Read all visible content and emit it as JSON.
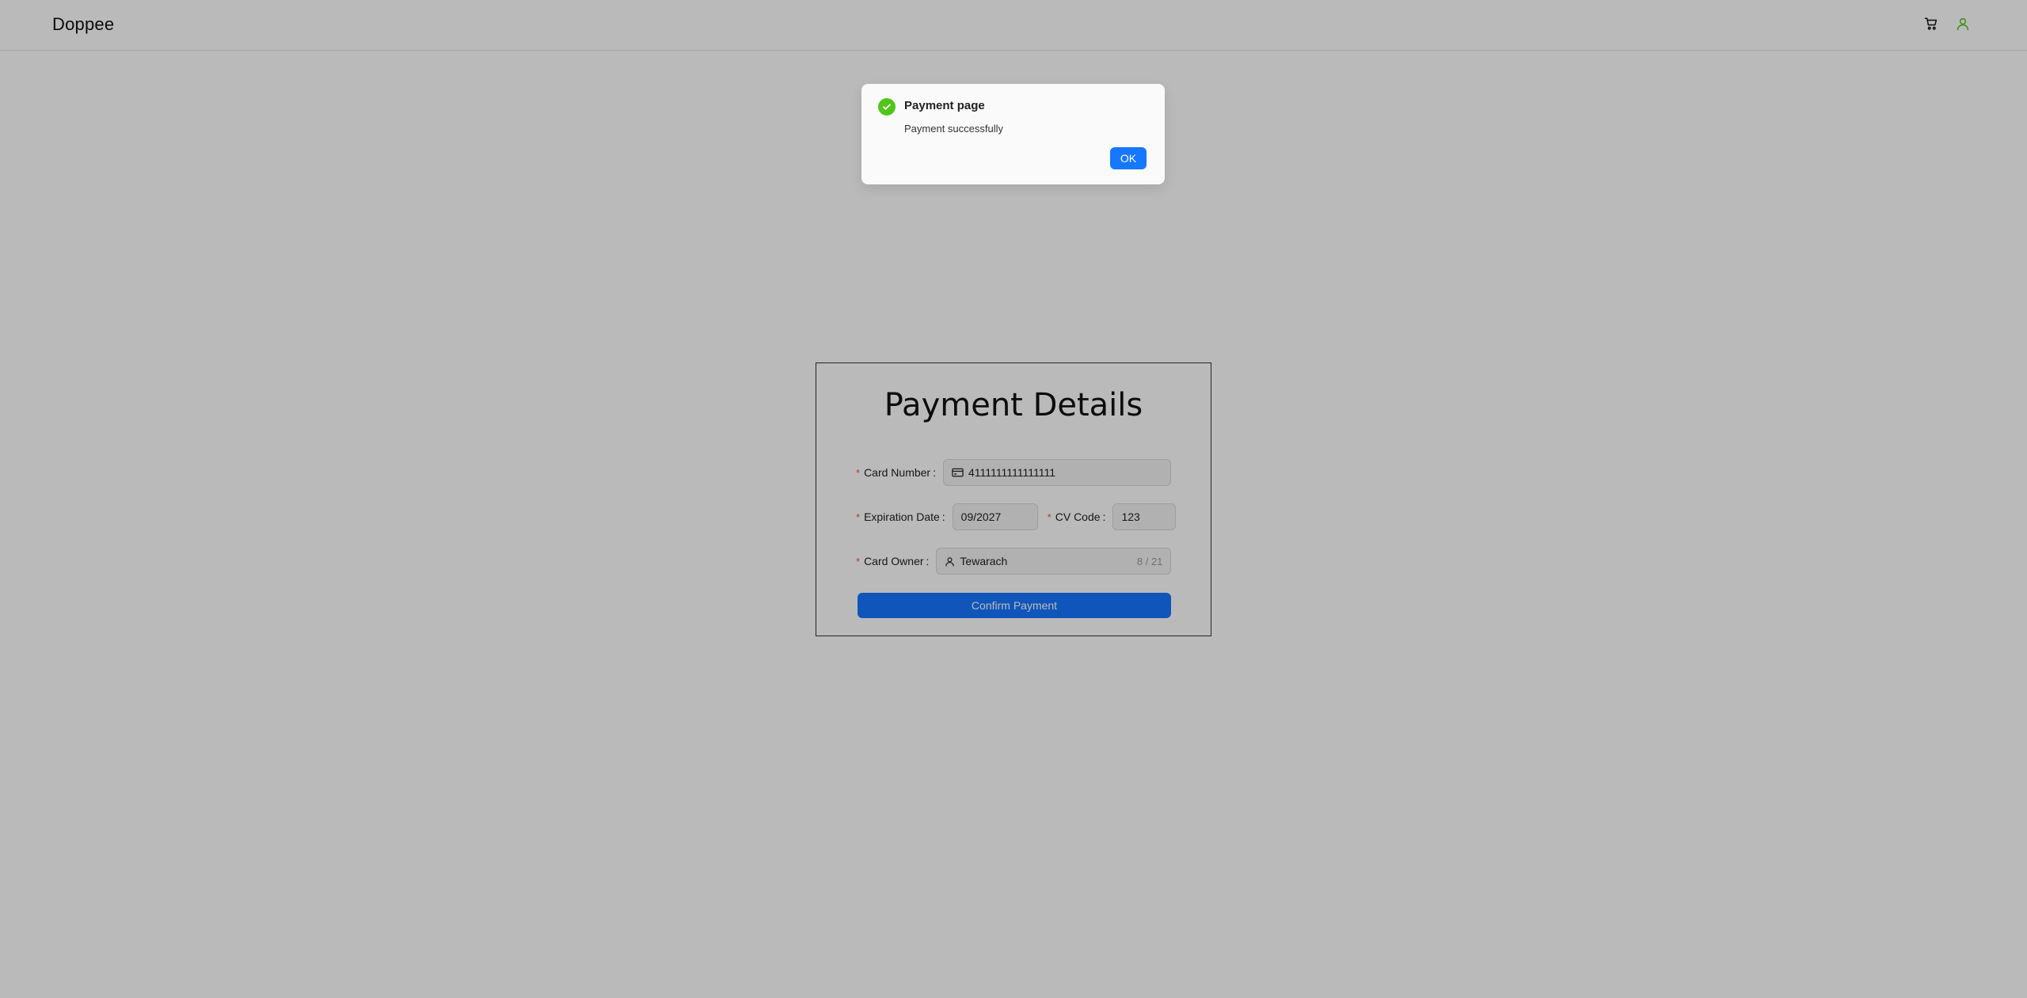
{
  "app": {
    "brand": "Doppee",
    "icons": {
      "cart": "cart-icon",
      "user": "user-icon"
    },
    "colors": {
      "primary": "#1677ff",
      "success": "#52c41a",
      "user_icon": "#52c41a",
      "required": "#ff4d4f"
    }
  },
  "form": {
    "title": "Payment Details",
    "card_number": {
      "label": "Card Number",
      "value": "4111111111111111",
      "icon": "credit-card-icon"
    },
    "expiration": {
      "label": "Expiration Date",
      "value": "09/2027"
    },
    "cv_code": {
      "label": "CV Code",
      "value": "123"
    },
    "card_owner": {
      "label": "Card Owner",
      "value": "Tewarach",
      "icon": "user-icon",
      "count": "8 / 21"
    },
    "confirm_label": "Confirm Payment"
  },
  "modal": {
    "title": "Payment page",
    "content": "Payment successfully",
    "ok_label": "OK",
    "icon": "check-circle-icon"
  }
}
